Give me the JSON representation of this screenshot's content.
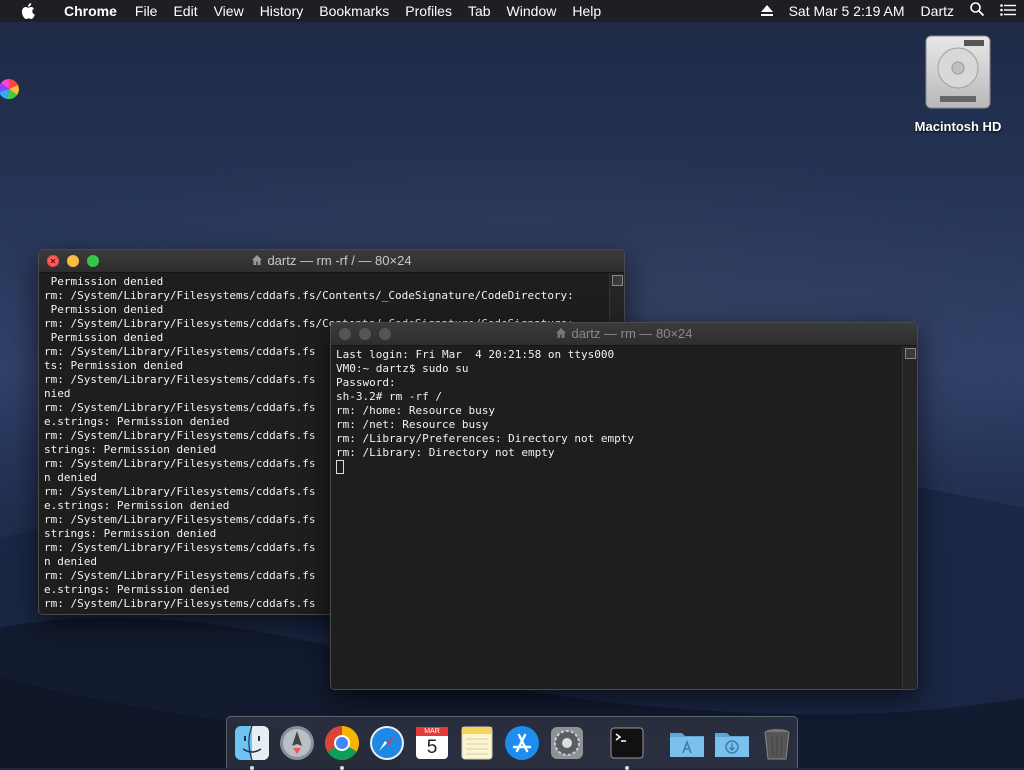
{
  "menubar": {
    "app_name": "Chrome",
    "items": [
      "File",
      "Edit",
      "View",
      "History",
      "Bookmarks",
      "Profiles",
      "Tab",
      "Window",
      "Help"
    ],
    "datetime": "Sat Mar 5  2:19 AM",
    "user": "Dartz"
  },
  "desktop": {
    "drive_label": "Macintosh HD"
  },
  "back_window": {
    "title": "dartz — rm -rf / — 80×24",
    "lines": [
      " Permission denied",
      "rm: /System/Library/Filesystems/cddafs.fs/Contents/_CodeSignature/CodeDirectory:",
      " Permission denied",
      "rm: /System/Library/Filesystems/cddafs.fs/Contents/_CodeSignature/CodeSignature:",
      " Permission denied",
      "rm: /System/Library/Filesystems/cddafs.fs",
      "ts: Permission denied",
      "rm: /System/Library/Filesystems/cddafs.fs",
      "nied",
      "rm: /System/Library/Filesystems/cddafs.fs",
      "e.strings: Permission denied",
      "rm: /System/Library/Filesystems/cddafs.fs",
      "strings: Permission denied",
      "rm: /System/Library/Filesystems/cddafs.fs",
      "n denied",
      "rm: /System/Library/Filesystems/cddafs.fs",
      "e.strings: Permission denied",
      "rm: /System/Library/Filesystems/cddafs.fs",
      "strings: Permission denied",
      "rm: /System/Library/Filesystems/cddafs.fs",
      "n denied",
      "rm: /System/Library/Filesystems/cddafs.fs",
      "e.strings: Permission denied",
      "rm: /System/Library/Filesystems/cddafs.fs"
    ]
  },
  "front_window": {
    "title": "dartz — rm — 80×24",
    "lines": [
      "Last login: Fri Mar  4 20:21:58 on ttys000",
      "VM0:~ dartz$ sudo su",
      "Password:",
      "sh-3.2# rm -rf /",
      "rm: /home: Resource busy",
      "rm: /net: Resource busy",
      "rm: /Library/Preferences: Directory not empty",
      "rm: /Library: Directory not empty"
    ]
  },
  "dock": {
    "calendar_month": "MAR",
    "calendar_day": "5",
    "apps": [
      "finder-icon",
      "launchpad-icon",
      "chrome-icon",
      "safari-icon",
      "calendar-icon",
      "notes-icon",
      "app-store-icon",
      "system-preferences-icon",
      "terminal-icon",
      "applications-folder-icon",
      "downloads-folder-icon",
      "trash-icon"
    ]
  }
}
